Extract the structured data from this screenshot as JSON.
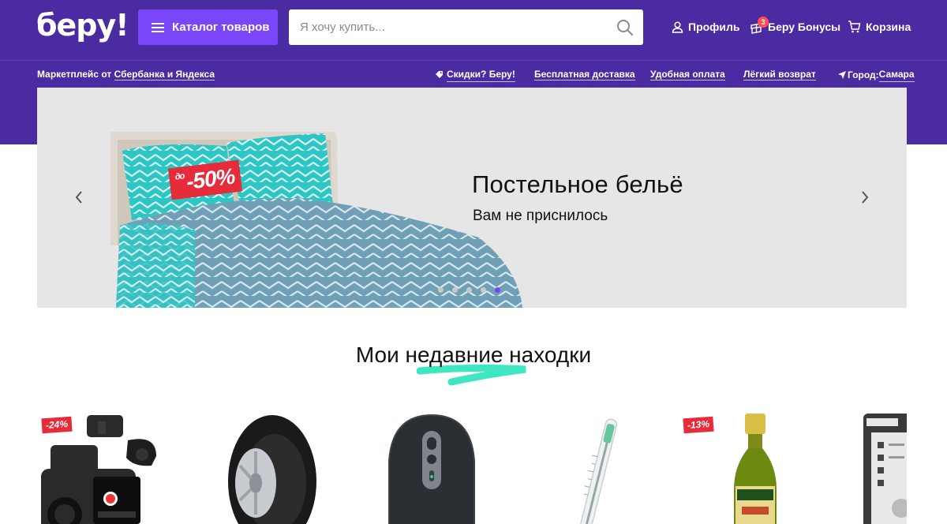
{
  "header": {
    "logo": "беру!",
    "catalog_label": "Каталог товаров",
    "search_placeholder": "Я хочу купить...",
    "profile_label": "Профиль",
    "bonuses_label": "Беру Бонусы",
    "bonuses_count": "3",
    "cart_label": "Корзина"
  },
  "subnav": {
    "marketplace_prefix": "Маркетплейс от ",
    "marketplace_link": "Сбербанка и Яндекса",
    "links": [
      "Скидки? Беру!",
      "Бесплатная доставка",
      "Удобная оплата",
      "Лёгкий возврат"
    ],
    "city_prefix": "Город: ",
    "city": "Самара"
  },
  "banner": {
    "title": "Постельное бельё",
    "subtitle": "Вам не приснилось",
    "sale_prefix": "до",
    "sale_value": "-50%",
    "slides_total": 5,
    "active_slide": 5
  },
  "section": {
    "title": "Мои недавние находки"
  },
  "products": [
    {
      "name": "dashcam",
      "discount": "-24%"
    },
    {
      "name": "winter-tire",
      "discount": ""
    },
    {
      "name": "computer-mouse",
      "discount": ""
    },
    {
      "name": "thermometer",
      "discount": ""
    },
    {
      "name": "olive-oil-bottle",
      "discount": "-13%"
    },
    {
      "name": "ebook-reader",
      "discount": ""
    }
  ],
  "colors": {
    "brand": "#4a2ba1",
    "accent": "#7b46f9",
    "sale": "#e62b3b",
    "highlight": "#3ee6c1"
  }
}
